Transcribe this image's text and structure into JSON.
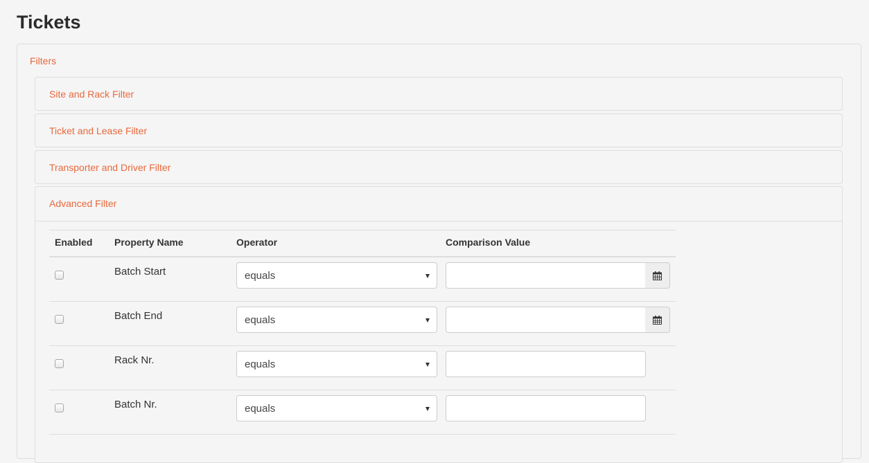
{
  "page_title": "Tickets",
  "filters": {
    "heading": "Filters",
    "panels": [
      {
        "label": "Site and Rack Filter"
      },
      {
        "label": "Ticket and Lease Filter"
      },
      {
        "label": "Transporter and Driver Filter"
      },
      {
        "label": "Advanced Filter"
      }
    ]
  },
  "advanced": {
    "columns": [
      "Enabled",
      "Property Name",
      "Operator",
      "Comparison Value"
    ],
    "rows": [
      {
        "property": "Batch Start",
        "operator": "equals",
        "value": "",
        "enabled": false,
        "has_date_picker": true
      },
      {
        "property": "Batch End",
        "operator": "equals",
        "value": "",
        "enabled": false,
        "has_date_picker": true
      },
      {
        "property": "Rack Nr.",
        "operator": "equals",
        "value": "",
        "enabled": false,
        "has_date_picker": false
      },
      {
        "property": "Batch Nr.",
        "operator": "equals",
        "value": "",
        "enabled": false,
        "has_date_picker": false
      }
    ]
  },
  "icons": {
    "date_picker": "calendar-icon",
    "dropdown": "caret-down-icon"
  },
  "colors": {
    "accent": "#e8683c",
    "background": "#f5f5f5",
    "border": "#dddddd"
  }
}
